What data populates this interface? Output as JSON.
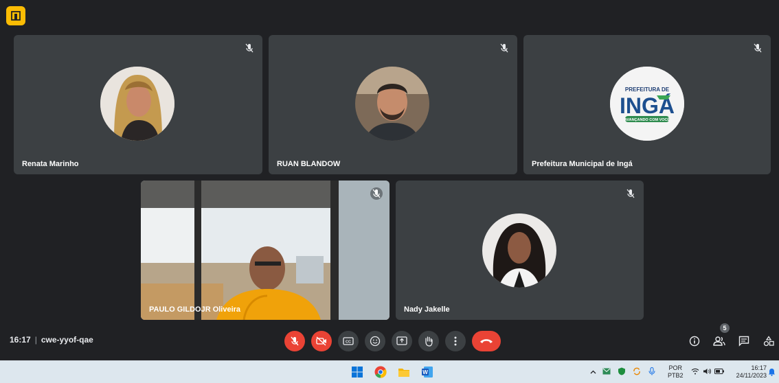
{
  "participants": [
    {
      "name": "Renata Marinho",
      "muted": true
    },
    {
      "name": "RUAN BLANDOW",
      "muted": true
    },
    {
      "name": "Prefeitura Municipal de Ingá",
      "muted": true,
      "logo": {
        "top": "PREFEITURA DE",
        "main": "INGÁ",
        "tagline": "AVANÇANDO COM VOCÊ"
      }
    },
    {
      "name": "PAULO GILDOJR Oliveira",
      "muted": true
    },
    {
      "name": "Nady Jakelle",
      "muted": true
    }
  ],
  "meeting": {
    "time": "16:17",
    "separator": "|",
    "code": "cwe-yyof-qae"
  },
  "controls": [
    "mic-off-icon",
    "camera-off-icon",
    "captions-icon",
    "emoji-icon",
    "present-icon",
    "raise-hand-icon",
    "more-options-icon",
    "end-call-icon"
  ],
  "side": {
    "people_count": "5"
  },
  "taskbar": {
    "language": "POR",
    "layout": "PTB2",
    "time": "16:17",
    "date": "24/11/2023"
  },
  "colors": {
    "background": "#202124",
    "tile": "#3c4043",
    "danger": "#ea4335",
    "accent": "#fbbc04"
  }
}
